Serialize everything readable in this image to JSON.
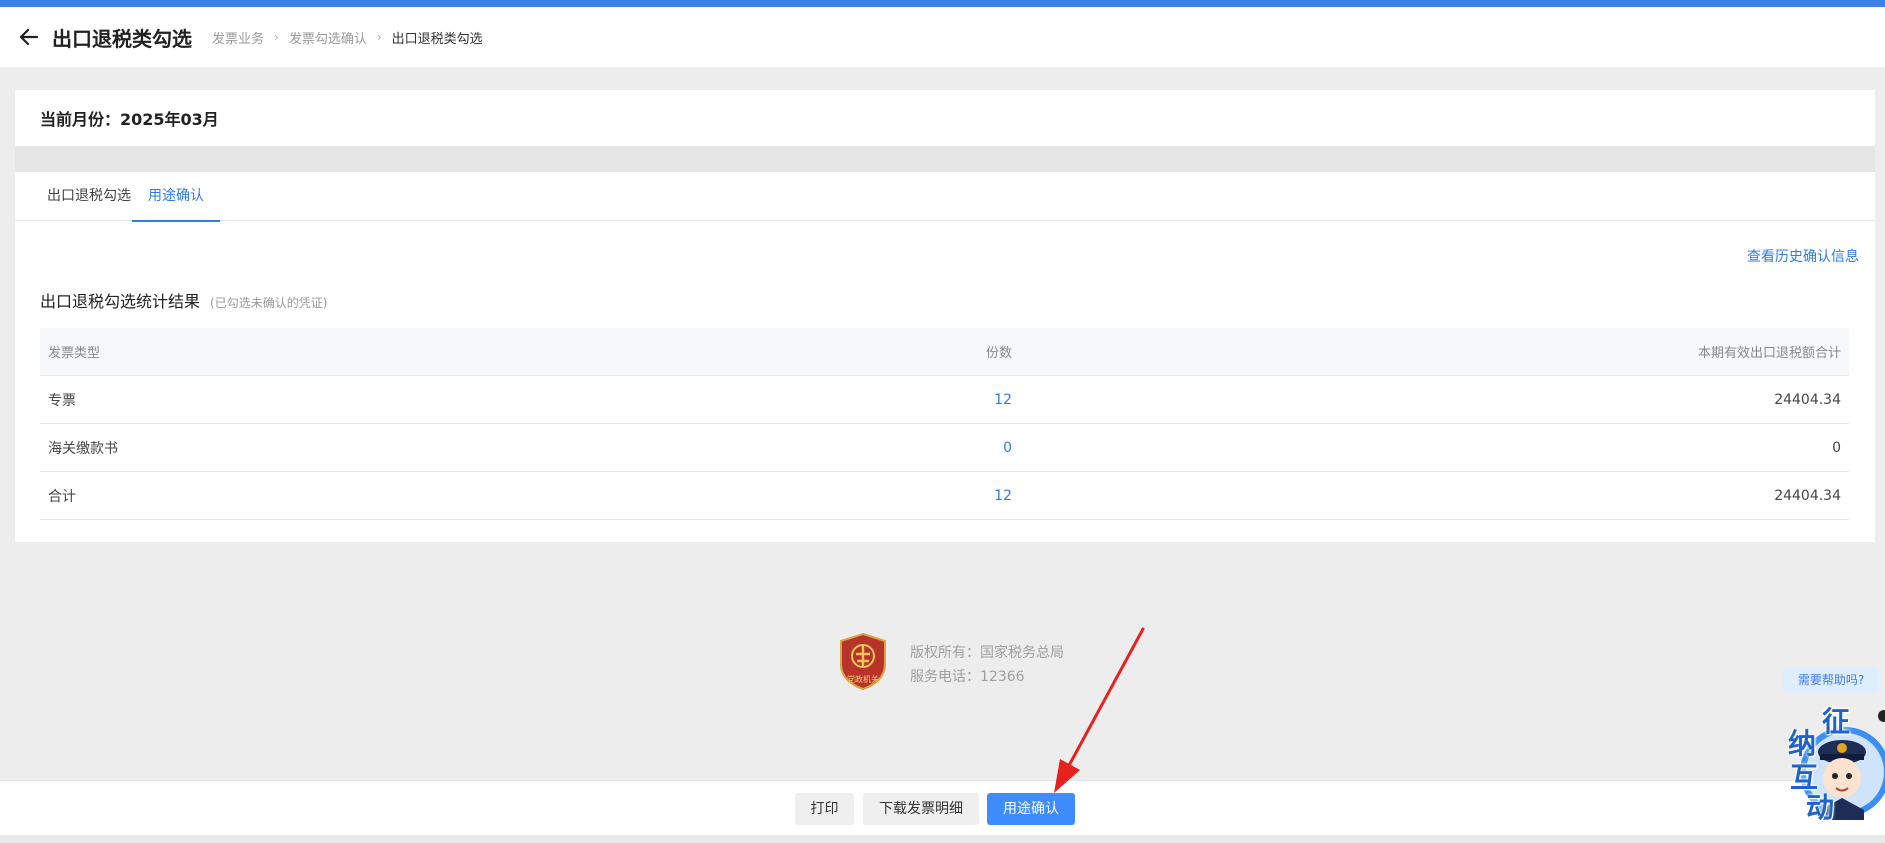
{
  "header": {
    "title": "出口退税类勾选",
    "breadcrumb": [
      "发票业务",
      "发票勾选确认",
      "出口退税类勾选"
    ]
  },
  "month": {
    "label": "当前月份：2025年03月"
  },
  "tabs": [
    {
      "label": "出口退税勾选",
      "active": false
    },
    {
      "label": "用途确认",
      "active": true
    }
  ],
  "history_link": "查看历史确认信息",
  "section": {
    "title": "出口退税勾选统计结果",
    "note": "(已勾选未确认的凭证)"
  },
  "table": {
    "headers": [
      "发票类型",
      "份数",
      "本期有效出口退税额合计"
    ],
    "rows": [
      {
        "type": "专票",
        "count": "12",
        "amount": "24404.34"
      },
      {
        "type": "海关缴款书",
        "count": "0",
        "amount": "0"
      },
      {
        "type": "合计",
        "count": "12",
        "amount": "24404.34"
      }
    ]
  },
  "footer": {
    "logo_text": "党政机关",
    "copyright": "版权所有：国家税务总局",
    "phone": "服务电话：12366"
  },
  "actions": {
    "print": "打印",
    "download": "下载发票明细",
    "confirm": "用途确认"
  },
  "assistant": {
    "help": "需要帮助吗?",
    "chars": [
      "征",
      "纳",
      "互",
      "动"
    ]
  },
  "colors": {
    "accent": "#3f7fe8",
    "primary_button": "#3f8cff",
    "annotation_arrow": "#e8201e"
  }
}
